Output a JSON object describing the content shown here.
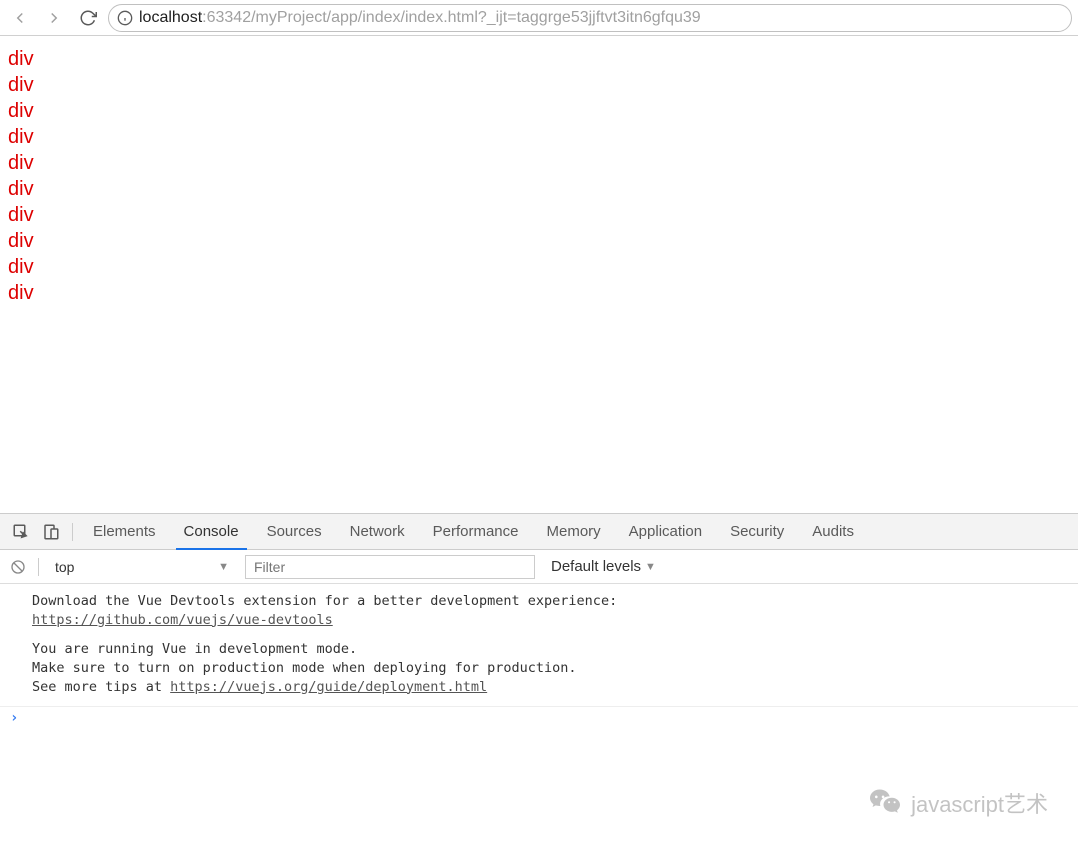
{
  "browser": {
    "url_host": "localhost",
    "url_rest": ":63342/myProject/app/index/index.html?_ijt=taggrge53jjftvt3itn6gfqu39"
  },
  "page": {
    "divs": [
      "div",
      "div",
      "div",
      "div",
      "div",
      "div",
      "div",
      "div",
      "div",
      "div"
    ]
  },
  "devtools": {
    "tabs": [
      "Elements",
      "Console",
      "Sources",
      "Network",
      "Performance",
      "Memory",
      "Application",
      "Security",
      "Audits"
    ],
    "active_tab": "Console",
    "console_toolbar": {
      "context": "top",
      "filter_placeholder": "Filter",
      "levels_label": "Default levels"
    },
    "console_messages": [
      {
        "lines": [
          "Download the Vue Devtools extension for a better development experience:",
          {
            "link": "https://github.com/vuejs/vue-devtools"
          }
        ]
      },
      {
        "lines": [
          "You are running Vue in development mode.",
          "Make sure to turn on production mode when deploying for production.",
          {
            "prefix": "See more tips at ",
            "link": "https://vuejs.org/guide/deployment.html"
          }
        ]
      }
    ]
  },
  "watermark": {
    "text": "javascript艺术"
  }
}
